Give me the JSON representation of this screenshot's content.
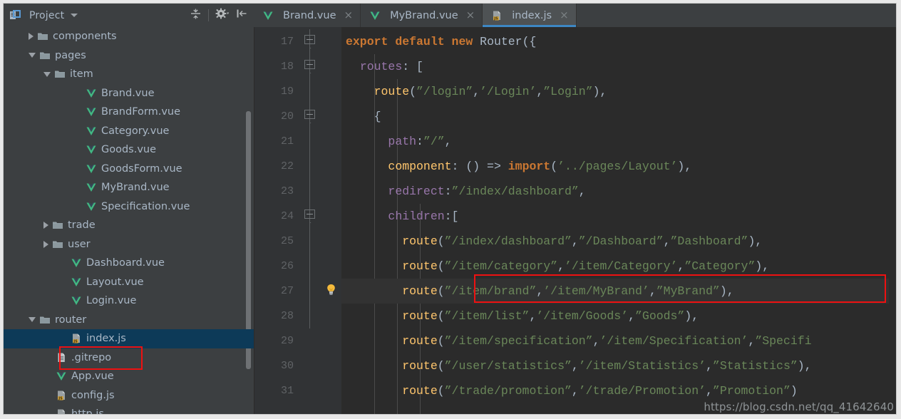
{
  "window": {
    "watermark": "https://blog.csdn.net/qq_41642640"
  },
  "project_panel": {
    "title": "Project",
    "icons": {
      "panel": "project-panel-icon",
      "dropdown": "chevron-down-icon",
      "collapse_all": "collapse-all-icon",
      "settings": "gear-icon",
      "hide": "hide-panel-icon"
    },
    "tree": [
      {
        "label": "components",
        "indent": 1,
        "state": "closed",
        "icon": "folder-icon",
        "selected": false
      },
      {
        "label": "pages",
        "indent": 1,
        "state": "open",
        "icon": "folder-icon",
        "selected": false
      },
      {
        "label": "item",
        "indent": 2,
        "state": "open",
        "icon": "folder-icon",
        "selected": false
      },
      {
        "label": "Brand.vue",
        "indent": 4,
        "state": "leaf",
        "icon": "vue-icon",
        "selected": false
      },
      {
        "label": "BrandForm.vue",
        "indent": 4,
        "state": "leaf",
        "icon": "vue-icon",
        "selected": false
      },
      {
        "label": "Category.vue",
        "indent": 4,
        "state": "leaf",
        "icon": "vue-icon",
        "selected": false
      },
      {
        "label": "Goods.vue",
        "indent": 4,
        "state": "leaf",
        "icon": "vue-icon",
        "selected": false
      },
      {
        "label": "GoodsForm.vue",
        "indent": 4,
        "state": "leaf",
        "icon": "vue-icon",
        "selected": false
      },
      {
        "label": "MyBrand.vue",
        "indent": 4,
        "state": "leaf",
        "icon": "vue-icon",
        "selected": false
      },
      {
        "label": "Specification.vue",
        "indent": 4,
        "state": "leaf",
        "icon": "vue-icon",
        "selected": false
      },
      {
        "label": "trade",
        "indent": 2,
        "state": "closed",
        "icon": "folder-icon",
        "selected": false
      },
      {
        "label": "user",
        "indent": 2,
        "state": "closed",
        "icon": "folder-icon",
        "selected": false
      },
      {
        "label": "Dashboard.vue",
        "indent": 3,
        "state": "leaf",
        "icon": "vue-icon",
        "selected": false
      },
      {
        "label": "Layout.vue",
        "indent": 3,
        "state": "leaf",
        "icon": "vue-icon",
        "selected": false
      },
      {
        "label": "Login.vue",
        "indent": 3,
        "state": "leaf",
        "icon": "vue-icon",
        "selected": false
      },
      {
        "label": "router",
        "indent": 1,
        "state": "open",
        "icon": "folder-icon",
        "selected": false
      },
      {
        "label": "index.js",
        "indent": 3,
        "state": "leaf",
        "icon": "js-icon",
        "selected": true
      },
      {
        "label": ".gitrepo",
        "indent": 2,
        "state": "leaf",
        "icon": "file-icon",
        "selected": false
      },
      {
        "label": "App.vue",
        "indent": 2,
        "state": "leaf",
        "icon": "vue-icon",
        "selected": false
      },
      {
        "label": "config.js",
        "indent": 2,
        "state": "leaf",
        "icon": "js-icon",
        "selected": false
      },
      {
        "label": "http.js",
        "indent": 2,
        "state": "leaf",
        "icon": "js-icon",
        "selected": false
      }
    ]
  },
  "tabs": [
    {
      "label": "Brand.vue",
      "icon": "vue-icon",
      "active": false,
      "close": "×"
    },
    {
      "label": "MyBrand.vue",
      "icon": "vue-icon",
      "active": false,
      "close": "×"
    },
    {
      "label": "index.js",
      "icon": "js-icon",
      "active": true,
      "close": "×"
    }
  ],
  "editor": {
    "first_line": 17,
    "lines": [
      {
        "num": "17",
        "fold": true,
        "bulb": false,
        "current": false,
        "indents": [],
        "tokens": [
          {
            "t": "export",
            "c": "kw"
          },
          {
            "t": " ",
            "c": "pn"
          },
          {
            "t": "default",
            "c": "kw"
          },
          {
            "t": " ",
            "c": "pn"
          },
          {
            "t": "new",
            "c": "kw"
          },
          {
            "t": " ",
            "c": "pn"
          },
          {
            "t": "Router",
            "c": "cls"
          },
          {
            "t": "({",
            "c": "pn"
          }
        ]
      },
      {
        "num": "18",
        "fold": true,
        "bulb": false,
        "current": false,
        "indents": [],
        "tokens": [
          {
            "t": "  ",
            "c": "pn"
          },
          {
            "t": "routes",
            "c": "prop"
          },
          {
            "t": ": [",
            "c": "pn"
          }
        ]
      },
      {
        "num": "19",
        "fold": false,
        "bulb": false,
        "current": false,
        "indents": [
          0
        ],
        "tokens": [
          {
            "t": "    ",
            "c": "pn"
          },
          {
            "t": "route",
            "c": "fn"
          },
          {
            "t": "(",
            "c": "pn"
          },
          {
            "t": "”/login”",
            "c": "str"
          },
          {
            "t": ",",
            "c": "pn"
          },
          {
            "t": "’/Login’",
            "c": "str"
          },
          {
            "t": ",",
            "c": "pn"
          },
          {
            "t": "”Login”",
            "c": "str"
          },
          {
            "t": "),",
            "c": "pn"
          }
        ]
      },
      {
        "num": "20",
        "fold": true,
        "bulb": false,
        "current": false,
        "indents": [
          0
        ],
        "tokens": [
          {
            "t": "    {",
            "c": "pn"
          }
        ]
      },
      {
        "num": "21",
        "fold": false,
        "bulb": false,
        "current": false,
        "indents": [
          0,
          1
        ],
        "tokens": [
          {
            "t": "      ",
            "c": "pn"
          },
          {
            "t": "path",
            "c": "prop"
          },
          {
            "t": ":",
            "c": "pn"
          },
          {
            "t": "”/”",
            "c": "str"
          },
          {
            "t": ",",
            "c": "pn"
          }
        ]
      },
      {
        "num": "22",
        "fold": false,
        "bulb": false,
        "current": false,
        "indents": [
          0,
          1
        ],
        "tokens": [
          {
            "t": "      ",
            "c": "pn"
          },
          {
            "t": "component",
            "c": "fn"
          },
          {
            "t": ": () => ",
            "c": "pn"
          },
          {
            "t": "import",
            "c": "kw"
          },
          {
            "t": "(",
            "c": "pn"
          },
          {
            "t": "’../pages/Layout’",
            "c": "str"
          },
          {
            "t": "),",
            "c": "pn"
          }
        ]
      },
      {
        "num": "23",
        "fold": false,
        "bulb": false,
        "current": false,
        "indents": [
          0,
          1
        ],
        "tokens": [
          {
            "t": "      ",
            "c": "pn"
          },
          {
            "t": "redirect",
            "c": "prop"
          },
          {
            "t": ":",
            "c": "pn"
          },
          {
            "t": "”/index/dashboard”",
            "c": "str"
          },
          {
            "t": ",",
            "c": "pn"
          }
        ]
      },
      {
        "num": "24",
        "fold": true,
        "bulb": false,
        "current": false,
        "indents": [
          0,
          1
        ],
        "tokens": [
          {
            "t": "      ",
            "c": "pn"
          },
          {
            "t": "children",
            "c": "prop"
          },
          {
            "t": ":[",
            "c": "pn"
          }
        ]
      },
      {
        "num": "25",
        "fold": false,
        "bulb": false,
        "current": false,
        "indents": [
          0,
          1,
          2
        ],
        "tokens": [
          {
            "t": "        ",
            "c": "pn"
          },
          {
            "t": "route",
            "c": "fn"
          },
          {
            "t": "(",
            "c": "pn"
          },
          {
            "t": "”/index/dashboard”",
            "c": "str"
          },
          {
            "t": ",",
            "c": "pn"
          },
          {
            "t": "”/Dashboard”",
            "c": "str"
          },
          {
            "t": ",",
            "c": "pn"
          },
          {
            "t": "”Dashboard”",
            "c": "str"
          },
          {
            "t": "),",
            "c": "pn"
          }
        ]
      },
      {
        "num": "26",
        "fold": false,
        "bulb": false,
        "current": false,
        "indents": [
          0,
          1,
          2
        ],
        "tokens": [
          {
            "t": "        ",
            "c": "pn"
          },
          {
            "t": "route",
            "c": "fn"
          },
          {
            "t": "(",
            "c": "pn"
          },
          {
            "t": "”/item/category”",
            "c": "str"
          },
          {
            "t": ",",
            "c": "pn"
          },
          {
            "t": "’/item/Category’",
            "c": "str"
          },
          {
            "t": ",",
            "c": "pn"
          },
          {
            "t": "”Category”",
            "c": "str"
          },
          {
            "t": "),",
            "c": "pn"
          }
        ]
      },
      {
        "num": "27",
        "fold": false,
        "bulb": true,
        "current": true,
        "indents": [
          0,
          1,
          2
        ],
        "tokens": [
          {
            "t": "        ",
            "c": "pn"
          },
          {
            "t": "route",
            "c": "fn"
          },
          {
            "t": "(",
            "c": "pn"
          },
          {
            "t": "”/item/brand”",
            "c": "str"
          },
          {
            "t": ",",
            "c": "pn"
          },
          {
            "t": "’/item/MyBrand’",
            "c": "str"
          },
          {
            "t": ",",
            "c": "pn"
          },
          {
            "t": "”MyBrand”",
            "c": "str"
          },
          {
            "t": "),",
            "c": "pn"
          }
        ]
      },
      {
        "num": "28",
        "fold": false,
        "bulb": false,
        "current": false,
        "indents": [
          0,
          1,
          2
        ],
        "tokens": [
          {
            "t": "        ",
            "c": "pn"
          },
          {
            "t": "route",
            "c": "fn"
          },
          {
            "t": "(",
            "c": "pn"
          },
          {
            "t": "”/item/list”",
            "c": "str"
          },
          {
            "t": ",",
            "c": "pn"
          },
          {
            "t": "’/item/Goods’",
            "c": "str"
          },
          {
            "t": ",",
            "c": "pn"
          },
          {
            "t": "”Goods”",
            "c": "str"
          },
          {
            "t": "),",
            "c": "pn"
          }
        ]
      },
      {
        "num": "29",
        "fold": false,
        "bulb": false,
        "current": false,
        "indents": [
          0,
          1,
          2
        ],
        "tokens": [
          {
            "t": "        ",
            "c": "pn"
          },
          {
            "t": "route",
            "c": "fn"
          },
          {
            "t": "(",
            "c": "pn"
          },
          {
            "t": "”/item/specification”",
            "c": "str"
          },
          {
            "t": ",",
            "c": "pn"
          },
          {
            "t": "’/item/Specification’",
            "c": "str"
          },
          {
            "t": ",",
            "c": "pn"
          },
          {
            "t": "”Specifi",
            "c": "str"
          }
        ]
      },
      {
        "num": "30",
        "fold": false,
        "bulb": false,
        "current": false,
        "indents": [
          0,
          1,
          2
        ],
        "tokens": [
          {
            "t": "        ",
            "c": "pn"
          },
          {
            "t": "route",
            "c": "fn"
          },
          {
            "t": "(",
            "c": "pn"
          },
          {
            "t": "”/user/statistics”",
            "c": "str"
          },
          {
            "t": ",",
            "c": "pn"
          },
          {
            "t": "’/item/Statistics’",
            "c": "str"
          },
          {
            "t": ",",
            "c": "pn"
          },
          {
            "t": "”Statistics”",
            "c": "str"
          },
          {
            "t": "),",
            "c": "pn"
          }
        ]
      },
      {
        "num": "31",
        "fold": false,
        "bulb": false,
        "current": false,
        "indents": [
          0,
          1,
          2
        ],
        "tokens": [
          {
            "t": "        ",
            "c": "pn"
          },
          {
            "t": "route",
            "c": "fn"
          },
          {
            "t": "(",
            "c": "pn"
          },
          {
            "t": "”/trade/promotion”",
            "c": "str"
          },
          {
            "t": ",",
            "c": "pn"
          },
          {
            "t": "’/trade/Promotion’",
            "c": "str"
          },
          {
            "t": ",",
            "c": "pn"
          },
          {
            "t": "”Promotion”",
            "c": "str"
          },
          {
            "t": ")",
            "c": "pn"
          }
        ]
      }
    ]
  },
  "colors": {
    "keyword": "#cc7832",
    "function": "#ffc66d",
    "string": "#6a8759",
    "property": "#9876aa",
    "plain": "#a9b7c6",
    "editor_bg": "#2b2b2b",
    "panel_bg": "#3c3f41",
    "selection": "#0d3a58",
    "highlight_box": "#ee1111",
    "tab_underline": "#3d87c4"
  }
}
